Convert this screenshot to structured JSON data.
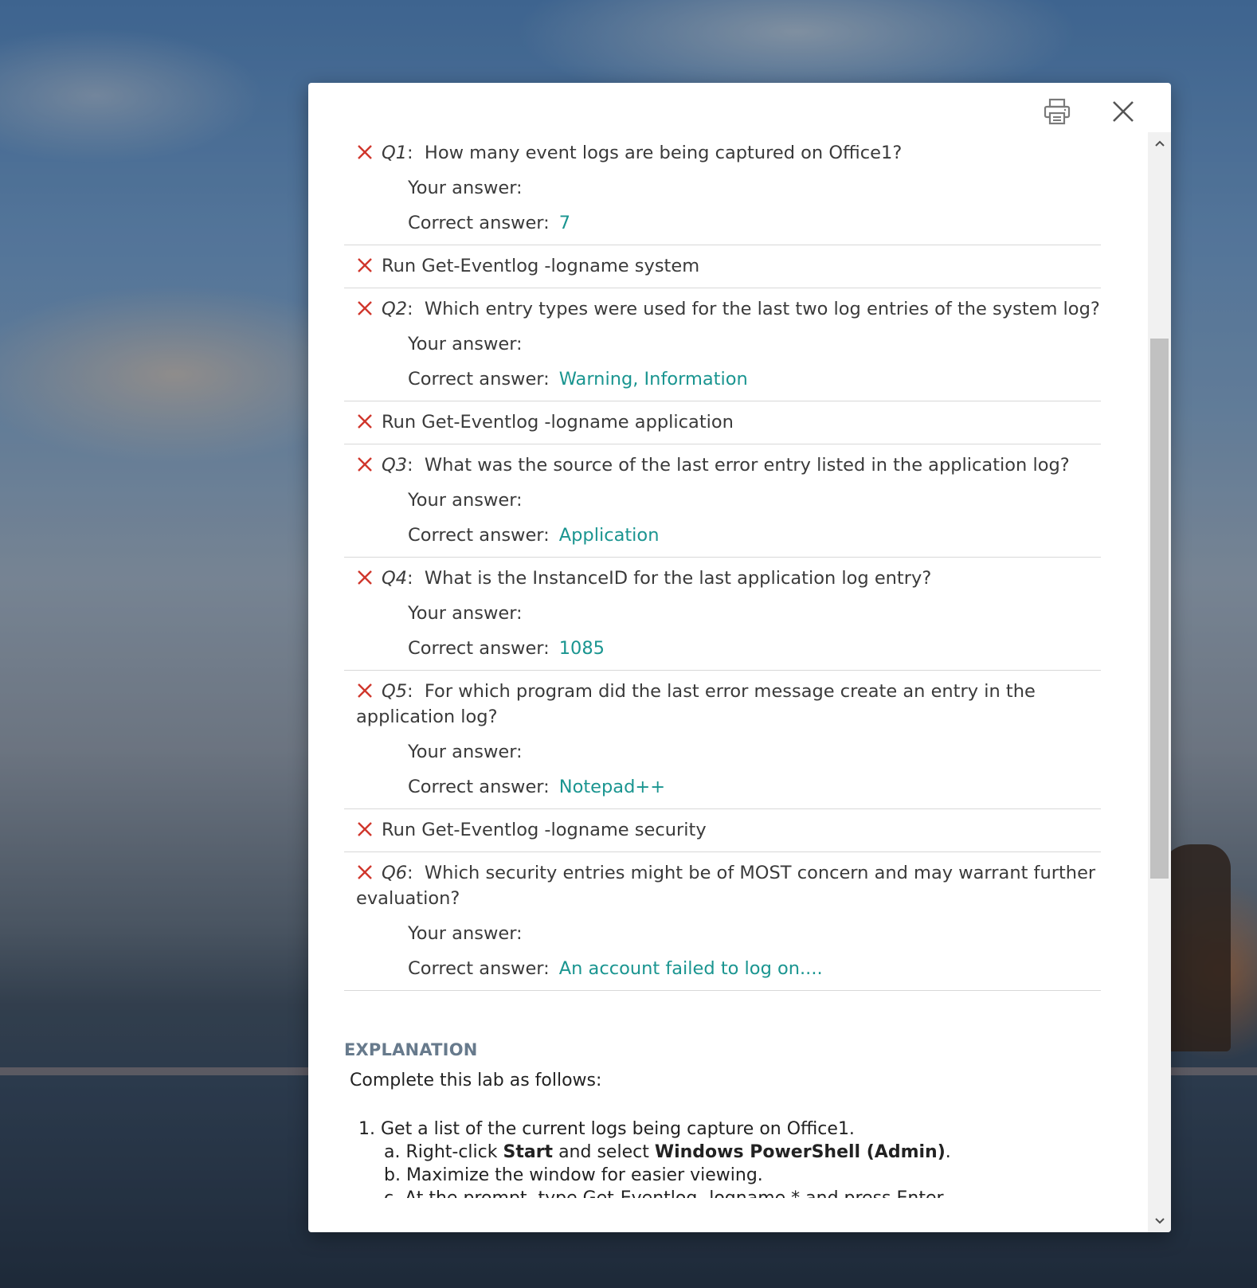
{
  "toolbar": {
    "print_icon": "printer-icon",
    "close_icon": "close-icon"
  },
  "labels": {
    "your_answer": "Your answer:",
    "correct_answer": "Correct answer:"
  },
  "colors": {
    "incorrect": "#d0362c",
    "correct_answer": "#1a9590",
    "heading": "#677a8c"
  },
  "items": [
    {
      "type": "question",
      "num": "Q1",
      "text": "How many event logs are being captured on Office1?",
      "your_answer": "",
      "correct_answer": "7"
    },
    {
      "type": "task",
      "text": "Run Get-Eventlog -logname system"
    },
    {
      "type": "question",
      "num": "Q2",
      "text": "Which entry types were used for the last two log entries of the system log?",
      "your_answer": "",
      "correct_answer": "Warning, Information"
    },
    {
      "type": "task",
      "text": "Run Get-Eventlog -logname application"
    },
    {
      "type": "question",
      "num": "Q3",
      "text": "What was the source of the last error entry listed in the application log?",
      "your_answer": "",
      "correct_answer": "Application"
    },
    {
      "type": "question",
      "num": "Q4",
      "text": "What is the InstanceID for the last application log entry?",
      "your_answer": "",
      "correct_answer": "1085"
    },
    {
      "type": "question",
      "num": "Q5",
      "text": "For which program did the last error message create an entry in the application log?",
      "your_answer": "",
      "correct_answer": "Notepad++"
    },
    {
      "type": "task",
      "text": "Run Get-Eventlog -logname security"
    },
    {
      "type": "question",
      "num": "Q6",
      "text": "Which security entries might be of MOST concern and may warrant further evaluation?",
      "your_answer": "",
      "correct_answer": "An account failed to log on...."
    }
  ],
  "explanation": {
    "heading": "EXPLANATION",
    "intro": "Complete this lab as follows:",
    "step1": "1. Get a list of the current logs being capture on Office1.",
    "step1a_pre": "a. Right-click ",
    "step1a_b1": "Start",
    "step1a_mid": " and select ",
    "step1a_b2": "Windows PowerShell (Admin)",
    "step1a_end": ".",
    "step1b": "b. Maximize the window for easier viewing.",
    "step1c_partial": "c. At the prompt, type Get-Eventlog -logname * and press Enter."
  }
}
